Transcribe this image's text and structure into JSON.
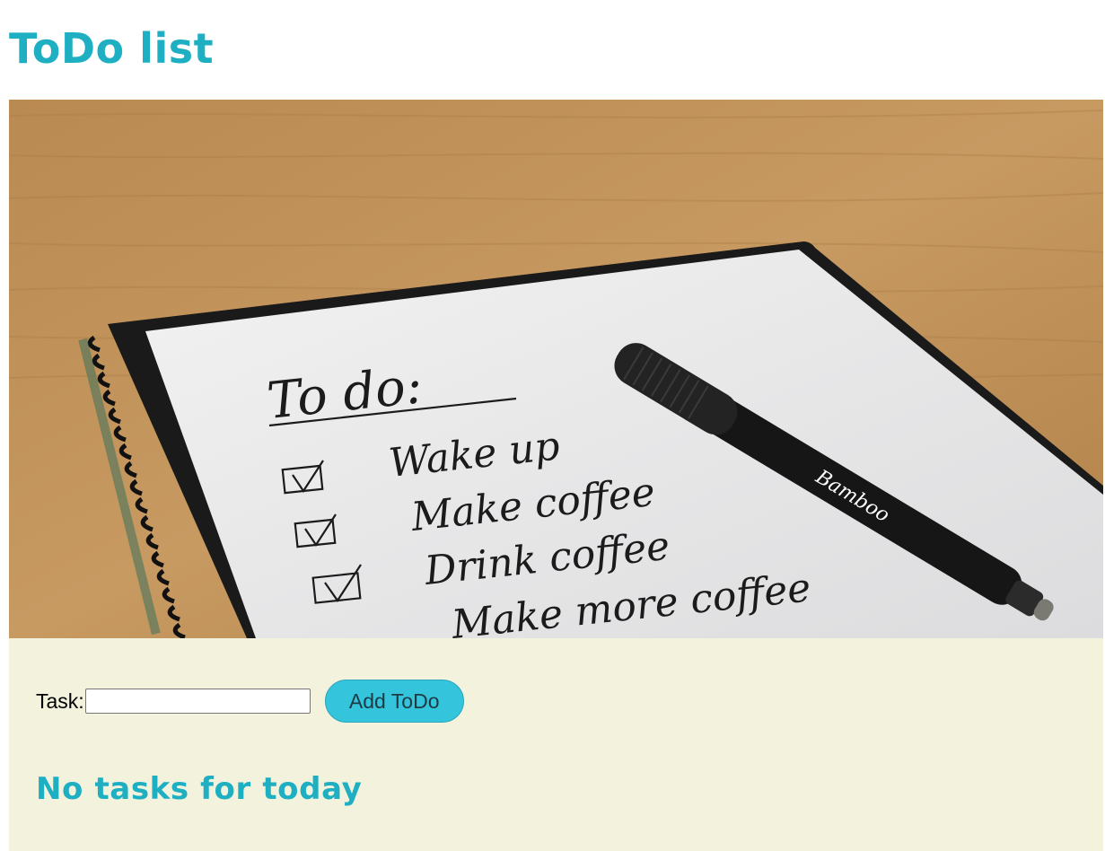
{
  "page": {
    "title": "ToDo list"
  },
  "hero_image": {
    "description_icon": "notebook-todo-photo",
    "handwriting": {
      "heading": "To do:",
      "items": [
        "Wake up",
        "Make coffee",
        "Drink coffee",
        "Make more coffee"
      ]
    },
    "pen_brand": "Bamboo"
  },
  "form": {
    "task_label": "Task:",
    "task_value": "",
    "task_placeholder": "",
    "add_button_label": "Add ToDo"
  },
  "status": {
    "empty_message": "No tasks for today"
  },
  "colors": {
    "accent": "#1eafc3",
    "button_bg": "#34c4dc",
    "panel_bg": "#f3f3dd"
  }
}
